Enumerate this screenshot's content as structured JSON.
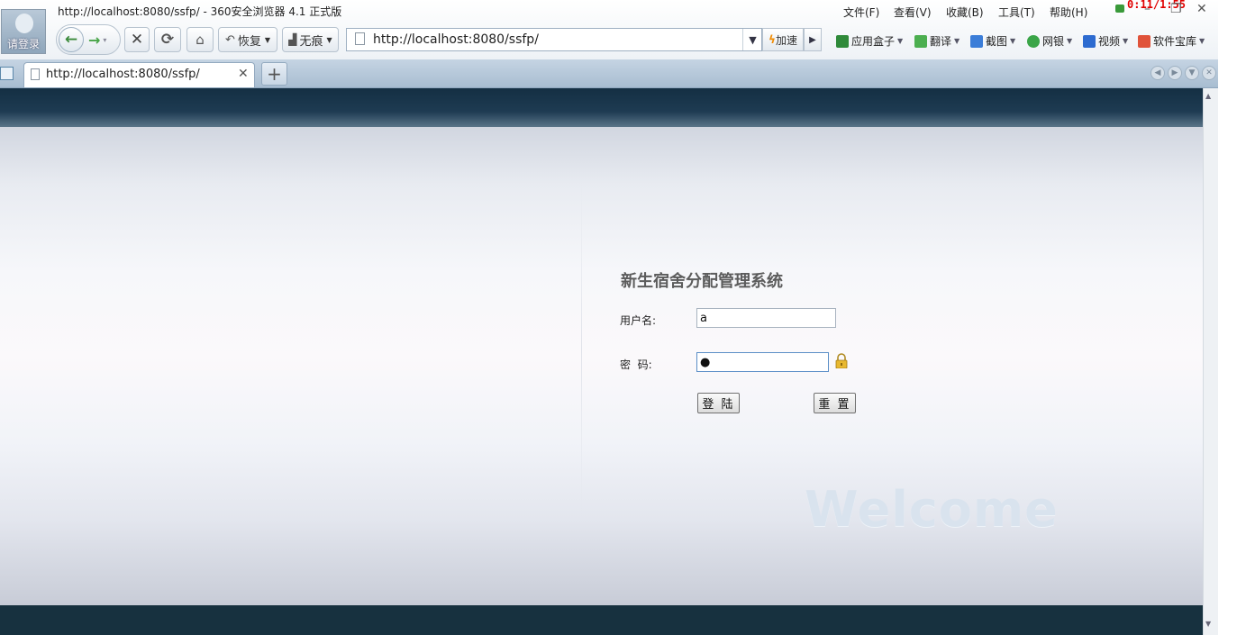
{
  "window": {
    "title": "http://localhost:8080/ssfp/ - 360安全浏览器 4.1 正式版",
    "login_label": "请登录",
    "clock": "0:11/1:55"
  },
  "menu": [
    "文件(F)",
    "查看(V)",
    "收藏(B)",
    "工具(T)",
    "帮助(H)"
  ],
  "toolbar": {
    "restore_label": "恢复",
    "incognito_label": "无痕",
    "address": "http://localhost:8080/ssfp/",
    "speed_label": "加速",
    "tools": [
      {
        "label": "应用盒子",
        "icon": "app-box-icon",
        "color": "#2f8a3a"
      },
      {
        "label": "翻译",
        "icon": "translate-icon",
        "color": "#4caf50"
      },
      {
        "label": "截图",
        "icon": "screenshot-icon",
        "color": "#3b7dd8"
      },
      {
        "label": "网银",
        "icon": "bank-icon",
        "color": "#3aa548"
      },
      {
        "label": "视频",
        "icon": "video-icon",
        "color": "#2d6bd0"
      },
      {
        "label": "软件宝库",
        "icon": "software-icon",
        "color": "#e0533a"
      }
    ]
  },
  "tab": {
    "label": "http://localhost:8080/ssfp/"
  },
  "page": {
    "system_title": "新生宿舍分配管理系统",
    "username_label": "用户名:",
    "username_value": "a",
    "password_label": "密  码:",
    "password_value": "●",
    "login_button": "登 陆",
    "reset_button": "重 置",
    "welcome": "Welcome"
  }
}
